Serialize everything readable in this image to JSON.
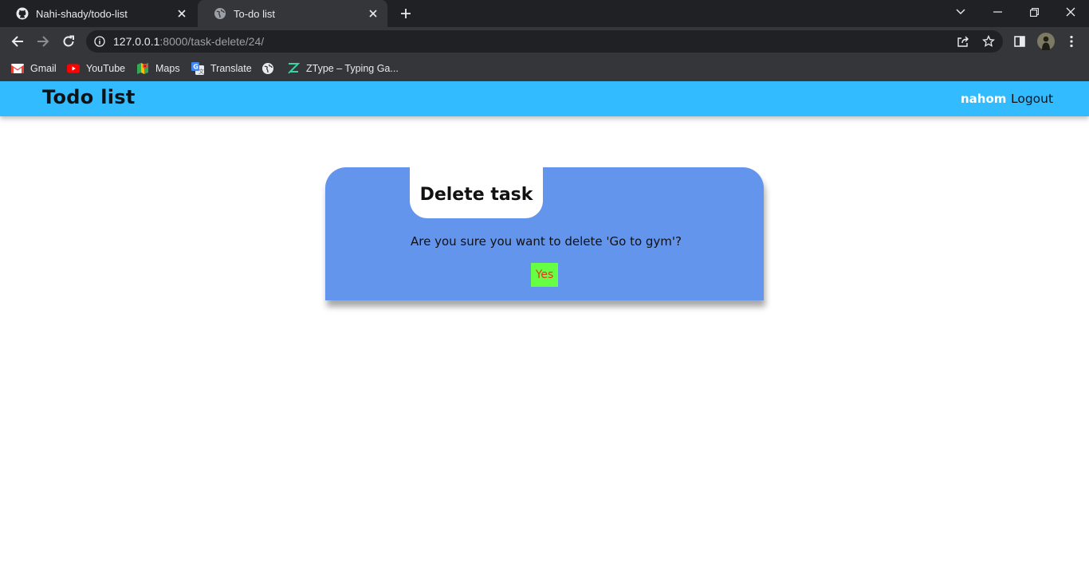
{
  "browser": {
    "tabs": [
      {
        "title": "Nahi-shady/todo-list",
        "icon": "github-icon",
        "active": false
      },
      {
        "title": "To-do list",
        "icon": "globe-icon",
        "active": true
      }
    ],
    "url": {
      "host": "127.0.0.1",
      "rest": ":8000/task-delete/24/"
    },
    "bookmarks": [
      {
        "label": "Gmail",
        "icon": "gmail-icon"
      },
      {
        "label": "YouTube",
        "icon": "youtube-icon"
      },
      {
        "label": "Maps",
        "icon": "maps-icon"
      },
      {
        "label": "Translate",
        "icon": "translate-icon"
      },
      {
        "label": "",
        "icon": "globe-icon"
      },
      {
        "label": "ZType – Typing Ga...",
        "icon": "ztype-icon"
      }
    ]
  },
  "navbar": {
    "brand": "Todo list",
    "username": "nahom",
    "logout_label": "Logout"
  },
  "delete_card": {
    "title": "Delete task",
    "question": "Are you sure you want to delete 'Go to gym'?",
    "confirm_label": "Yes"
  },
  "colors": {
    "navbar_bg": "#33bbff",
    "card_bg": "#6495ed",
    "confirm_bg": "#66ff44",
    "confirm_text": "#e03a1e"
  }
}
